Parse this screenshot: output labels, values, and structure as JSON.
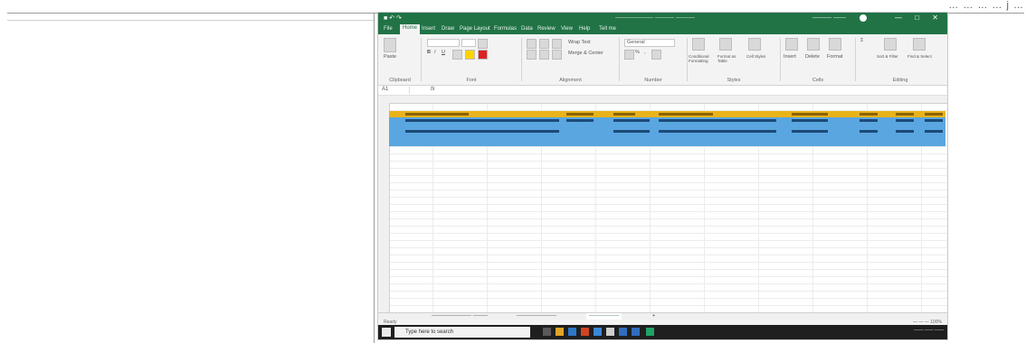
{
  "page": {
    "corner_text": "… … … … j …"
  },
  "excel": {
    "title": "—————— ——— ———",
    "qat": "■ ↶ ↷",
    "user": "——— ——",
    "window_controls": "— □ ✕",
    "tabs": [
      "File",
      "Home",
      "Insert",
      "Draw",
      "Page Layout",
      "Formulas",
      "Data",
      "Review",
      "View",
      "Help",
      "Tell me"
    ],
    "active_tab": "Home",
    "ribbon_groups": [
      "Clipboard",
      "Font",
      "Alignment",
      "Number",
      "Styles",
      "Cells",
      "Editing"
    ],
    "paste_label": "Paste",
    "wrap_label": "Wrap Text",
    "merge_label": "Merge & Center",
    "number_format": "General",
    "cond_format_label": "Conditional Formatting",
    "format_table_label": "Format as Table",
    "cell_styles_label": "Cell Styles",
    "insert_label": "Insert",
    "delete_label": "Delete",
    "format_label": "Format",
    "sort_label": "Sort & Filter",
    "find_label": "Find & Select",
    "name_box": "A1",
    "fx": "fx",
    "sheet_tabs": [
      "———————— ———",
      "————————",
      "——————"
    ],
    "active_sheet_index": 2,
    "add_sheet": "+",
    "status_left": "Ready",
    "status_right": "— — — 100%",
    "search_placeholder": "Type here to search",
    "tray_text": "—— —— ——",
    "row_count": 27,
    "colors": {
      "excel_green": "#217346",
      "header_yellow": "#e9b31a",
      "row_blue": "#5aa6e0",
      "taskbar": "#1f1f1f"
    }
  }
}
